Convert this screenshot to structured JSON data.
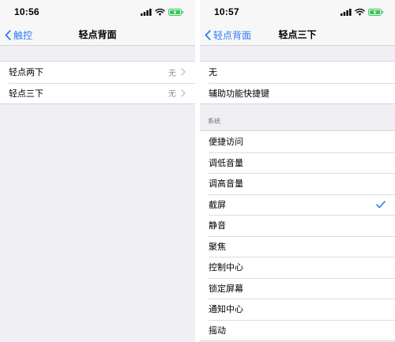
{
  "left": {
    "status": {
      "time": "10:56"
    },
    "nav": {
      "back_label": "触控",
      "title": "轻点背面"
    },
    "rows": [
      {
        "label": "轻点两下",
        "value": "无"
      },
      {
        "label": "轻点三下",
        "value": "无"
      }
    ]
  },
  "right": {
    "status": {
      "time": "10:57"
    },
    "nav": {
      "back_label": "轻点背面",
      "title": "轻点三下"
    },
    "top_rows": [
      {
        "label": "无"
      },
      {
        "label": "辅助功能快捷键"
      }
    ],
    "section_header": "系统",
    "system_rows": [
      {
        "label": "便捷访问"
      },
      {
        "label": "调低音量"
      },
      {
        "label": "调高音量"
      },
      {
        "label": "截屏",
        "selected": true
      },
      {
        "label": "静音"
      },
      {
        "label": "聚焦"
      },
      {
        "label": "控制中心"
      },
      {
        "label": "锁定屏幕"
      },
      {
        "label": "通知中心"
      },
      {
        "label": "摇动"
      }
    ]
  },
  "colors": {
    "accent": "#2f7cf6",
    "battery": "#35c759",
    "background": "#efeff4",
    "secondary_text": "#8e8e93"
  },
  "icons": [
    "signal-icon",
    "wifi-icon",
    "battery-charging-icon",
    "chevron-left-icon",
    "chevron-right-icon",
    "checkmark-icon"
  ]
}
